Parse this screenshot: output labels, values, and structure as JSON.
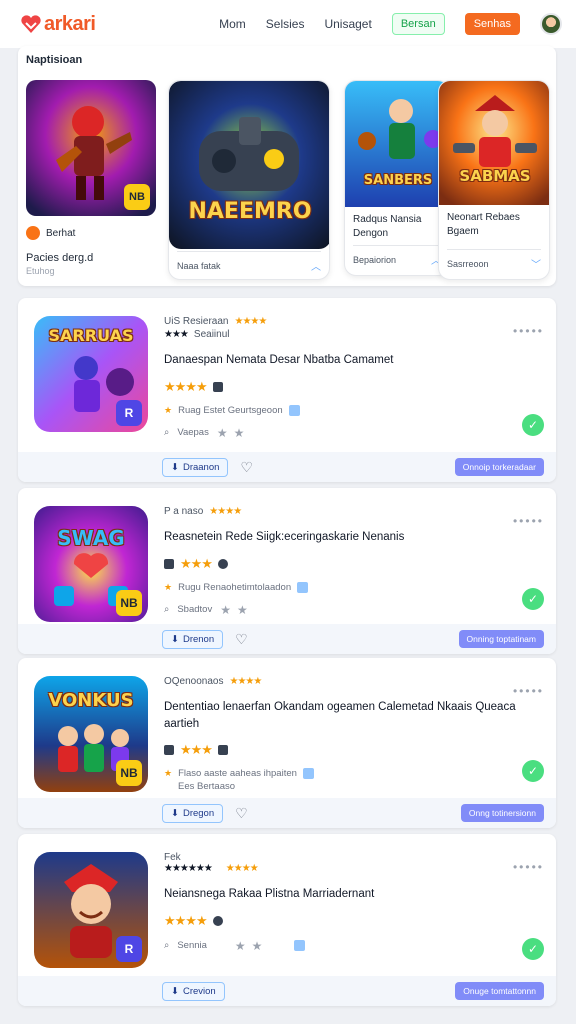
{
  "header": {
    "logo": "arkari",
    "nav": [
      "Mom",
      "Selsies",
      "Unisaget"
    ],
    "outline_btn": "Bersan",
    "solid_btn": "Senhas"
  },
  "featured": {
    "title": "Naptisioan",
    "small": {
      "badge": "Berhat",
      "name": "Pacies derg.d",
      "sub": "Etuhog",
      "icon_text": "NB"
    },
    "main": {
      "art_text": "NAEEMRO",
      "foot": "Naaa fatak"
    },
    "third": {
      "art_text": "SANBERS",
      "desc": "Radqus Nansia Dengon",
      "foot": "Bepaiorion"
    },
    "fourth": {
      "art_text": "SABMAS",
      "desc": "Neonart Rebaes Bgaem",
      "foot": "Sasrreoon"
    }
  },
  "cards": [
    {
      "thumb_text": "SARRUAS",
      "badge": "R",
      "meta": "UiS Resieraan",
      "meta_sub": "Seaiinul",
      "title": "Danaespan Nemata Desar Nbatba Camamet",
      "info": "Ruag Estet Geurtsgeoon",
      "sub": "Vaepas",
      "footer_left": "Draanon",
      "footer_right": "Onnoip torkeradaar"
    },
    {
      "thumb_text": "SWAG",
      "badge": "NB",
      "meta": "P a naso",
      "title": "Reasnetein Rede Siigk:eceringaskarie Nenanis",
      "info": "Rugu Renaohetimtolaadon",
      "sub": "Sbadtov",
      "footer_left": "Drenon",
      "footer_right": "Onning toptatinam"
    },
    {
      "thumb_text": "VONKUS",
      "badge": "NB",
      "meta": "OQenoonaos",
      "title": "Dententiao lenaerfan Okandam ogeamen Calemetad Nkaais Queaca aartieh",
      "info": "Flaso aaste aaheas ihpaiten",
      "info2": "Ees Bertaaso",
      "footer_left": "Dregon",
      "footer_right": "Onng totinersionn"
    },
    {
      "thumb_text": "",
      "badge": "R",
      "meta": "Fek",
      "title": "Neiansnega Rakaa Plistna Marriadernant",
      "info": "",
      "sub": "Sennia",
      "footer_left": "Crevion",
      "footer_right": "Onuge tomtattonnn"
    }
  ]
}
